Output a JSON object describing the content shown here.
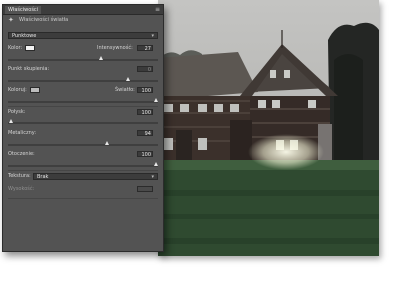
{
  "panel": {
    "tab_label": "Właściwości",
    "menu_icon": "panel-menu-icon",
    "title_icon": "lightbulb-icon",
    "title": "Właściwości światła",
    "light_type": {
      "value": "Punktowe"
    },
    "color_label": "Kolor:",
    "color_value": "#f2f2f2",
    "intensity_label": "Intensywność:",
    "intensity_value": "27",
    "hotspot_label": "Punkt skupienia:",
    "hotspot_value": "0",
    "colorize_label": "Koloruj:",
    "colorize_color": "#bcbcbc",
    "exposure_label": "Światło:",
    "exposure_value": "100",
    "gloss_label": "Połysk:",
    "gloss_value": "100",
    "metallic_label": "Metaliczny:",
    "metallic_value": "94",
    "ambience_label": "Otoczenie:",
    "ambience_value": "100",
    "texture_label": "Tekstura:",
    "texture_value": "Brak",
    "height_label": "Wysokość:",
    "height_value": ""
  },
  "sliders": {
    "intensity": 0.62,
    "hotspot": 0.8,
    "colorize": 0.53,
    "exposure": 0.99,
    "gloss": 0.02,
    "metallic": 0.66,
    "ambience": 0.99
  },
  "photo": {
    "description_none": ""
  }
}
